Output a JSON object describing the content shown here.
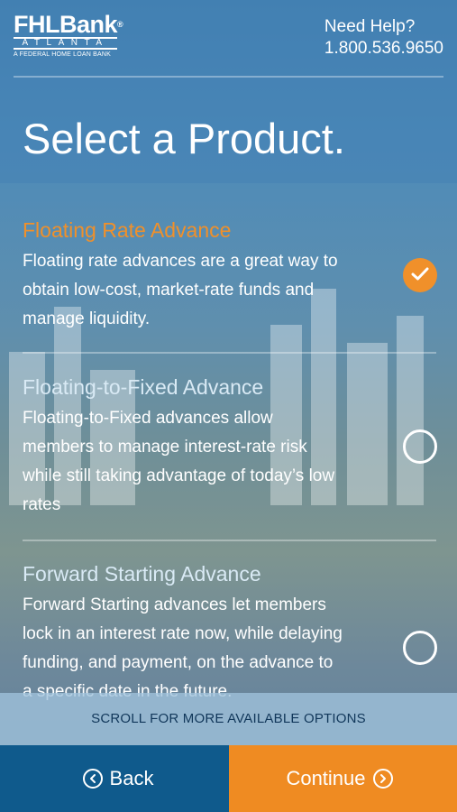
{
  "header": {
    "logo_name": "FHLBank",
    "logo_reg": "®",
    "logo_city": "ATLANTA",
    "logo_tagline": "A FEDERAL HOME LOAN BANK",
    "help_label": "Need Help?",
    "help_phone": "1.800.536.9650"
  },
  "title": "Select a Product.",
  "products": [
    {
      "name": "Floating Rate Advance",
      "description": "Floating rate advances are a great way to obtain low-cost, market-rate funds and manage liquidity.",
      "selected": true
    },
    {
      "name": "Floating-to-Fixed Advance",
      "description": "Floating-to-Fixed advances allow members to manage interest-rate risk while still taking advantage of today’s low rates",
      "selected": false
    },
    {
      "name": "Forward Starting Advance",
      "description": "Forward Starting advances let members lock in an interest rate now, while delaying funding, and payment, on the advance to a specific date in the future.",
      "selected": false
    }
  ],
  "scroll_note": "SCROLL FOR MORE AVAILABLE OPTIONS",
  "footer": {
    "back_label": "Back",
    "continue_label": "Continue"
  },
  "colors": {
    "accent": "#f0902a",
    "back_bg": "#0f5a8c",
    "continue_bg": "#ef8b22"
  },
  "icons": {
    "check": "check-icon",
    "back": "chevron-left-circle-icon",
    "continue": "chevron-right-circle-icon"
  }
}
